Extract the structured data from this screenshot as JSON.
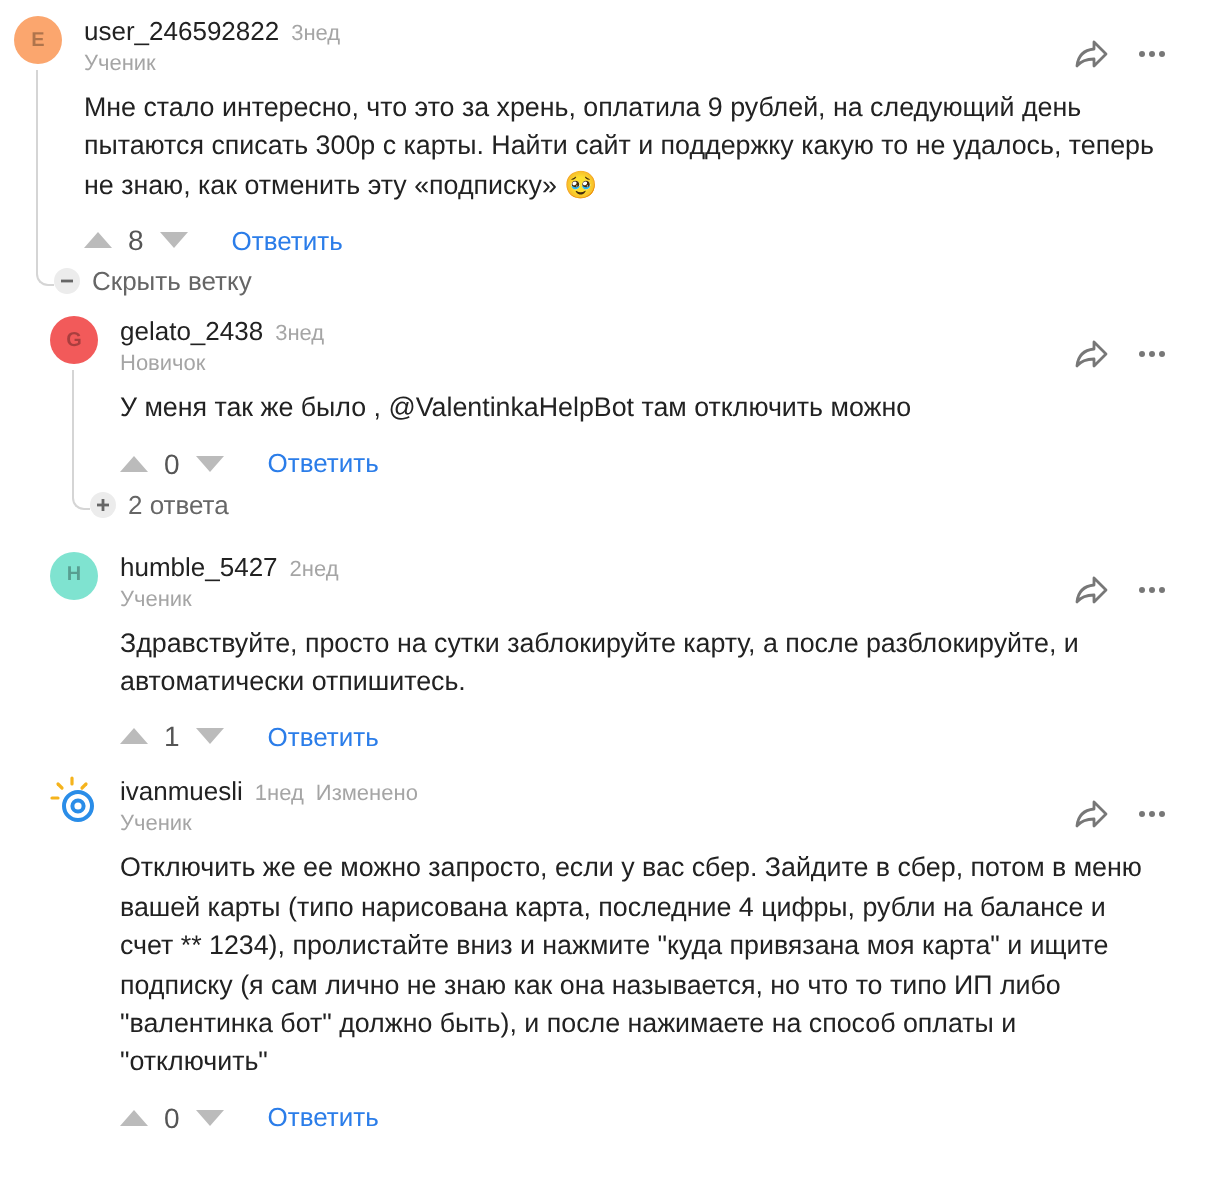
{
  "comments": [
    {
      "author": "user_246592822",
      "time": "3нед",
      "rank": "Ученик",
      "avatar": {
        "kind": "letter",
        "letter": "E",
        "color": "#fba66e"
      },
      "text": "Мне стало интересно, что это за хрень, оплатила 9 рублей, на следующий день пытаются списать 300р с карты. Найти сайт и поддержку какую то не удалось, теперь не знаю, как отменить эту «подписку» 🥹",
      "votes": "8",
      "reply": "Ответить",
      "toggle": {
        "expanded": true,
        "label": "Скрыть ветку"
      },
      "children": [
        {
          "author": "gelato_2438",
          "time": "3нед",
          "rank": "Новичок",
          "avatar": {
            "kind": "letter",
            "letter": "G",
            "color": "#f25a5a"
          },
          "text": "У меня так же было , @ValentinkaHelpBot там отключить можно",
          "votes": "0",
          "reply": "Ответить",
          "toggle": {
            "expanded": false,
            "label": "2 ответа"
          }
        },
        {
          "author": "humble_5427",
          "time": "2нед",
          "rank": "Ученик",
          "avatar": {
            "kind": "letter",
            "letter": "H",
            "color": "#7fe3d0"
          },
          "text": "Здравствуйте, просто на сутки заблокируйте карту, а после разблокируйте, и автоматически отпишитесь.",
          "votes": "1",
          "reply": "Ответить"
        },
        {
          "author": "ivanmuesli",
          "time": "1нед",
          "edited": "Изменено",
          "rank": "Ученик",
          "avatar": {
            "kind": "logo"
          },
          "text": "Отключить же ее можно запросто, если у вас сбер. Зайдите в сбер, потом в меню вашей карты (типо нарисована карта, последние 4 цифры, рубли на балансе и счет ** 1234), пролистайте вниз и нажмите \"куда привязана моя карта\" и ищите подписку (я сам лично не знаю как она называется, но что то типо ИП либо \"валентинка бот\" должно быть), и после нажимаете на способ оплаты и \"отключить\"",
          "votes": "0",
          "reply": "Ответить"
        }
      ]
    }
  ]
}
